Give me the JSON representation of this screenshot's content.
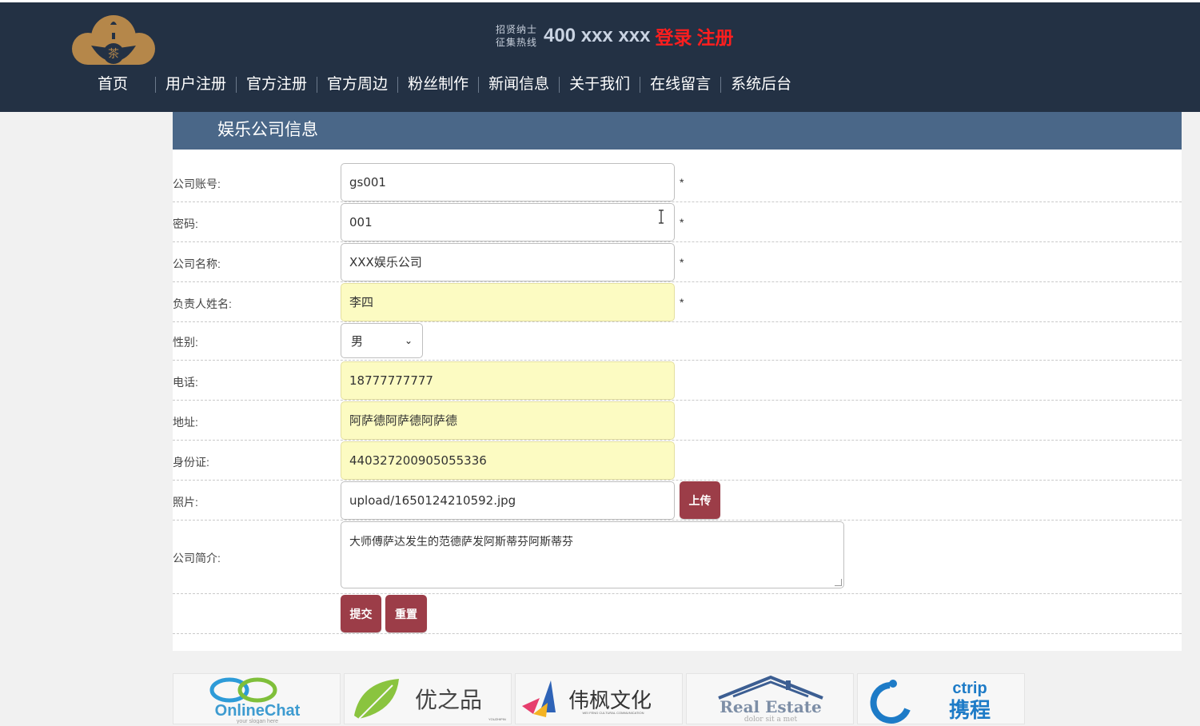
{
  "header": {
    "logo_char": "茶",
    "hotline_label_line1": "招贤纳士",
    "hotline_label_line2": "征集热线",
    "hotline_number": "400 xxx xxx",
    "login_label": "登录",
    "register_label": "注册"
  },
  "nav": [
    "首页",
    "用户注册",
    "官方注册",
    "官方周边",
    "粉丝制作",
    "新闻信息",
    "关于我们",
    "在线留言",
    "系统后台"
  ],
  "panel": {
    "title": "娱乐公司信息"
  },
  "form": {
    "account": {
      "label": "公司账号:",
      "value": "gs001",
      "required": "*"
    },
    "password": {
      "label": "密码:",
      "value": "001",
      "required": "*"
    },
    "company_name": {
      "label": "公司名称:",
      "value": "XXX娱乐公司",
      "required": "*"
    },
    "manager_name": {
      "label": "负责人姓名:",
      "value": "李四",
      "required": "*"
    },
    "gender": {
      "label": "性别:",
      "value": "男"
    },
    "phone": {
      "label": "电话:",
      "value": "18777777777"
    },
    "address": {
      "label": "地址:",
      "value": "阿萨德阿萨德阿萨德"
    },
    "id_card": {
      "label": "身份证:",
      "value": "440327200905055336"
    },
    "photo": {
      "label": "照片:",
      "value": "upload/1650124210592.jpg",
      "upload_label": "上传"
    },
    "intro": {
      "label": "公司简介:",
      "value": "大师傅萨达发生的范德萨发阿斯蒂芬阿斯蒂芬"
    },
    "submit_label": "提交",
    "reset_label": "重置"
  },
  "partners": {
    "p1": {
      "title": "OnlineChat",
      "sub": "your slogan here"
    },
    "p2": {
      "title": "优之品",
      "sub": "YOUZHIPIN"
    },
    "p3": {
      "title": "伟枫文化",
      "sub": "WEI FENG CULTURAL COMMUNICATION"
    },
    "p4": {
      "title": "Real Estate",
      "sub": "dolor sit a met"
    },
    "p5": {
      "title_en": "ctrip",
      "title_cn": "携程"
    }
  },
  "colors": {
    "header_bg": "#233144",
    "panel_header_bg": "#4a6788",
    "button_bg": "#9c3d48",
    "highlight_input": "#fcfbc2",
    "alert_red": "#ff1e1e"
  }
}
